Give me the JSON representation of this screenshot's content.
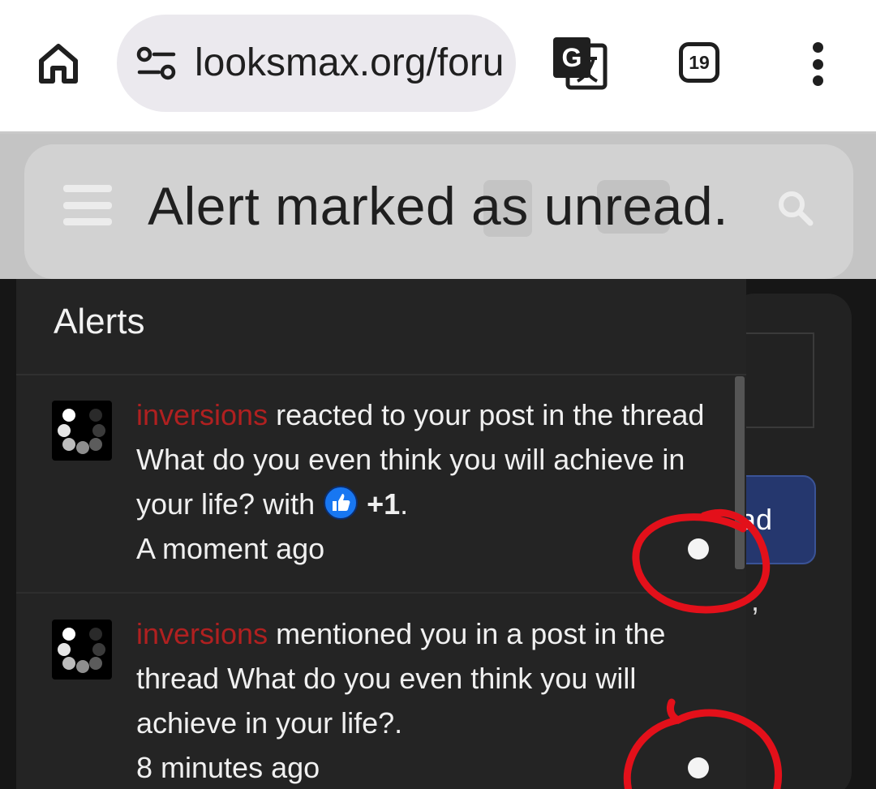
{
  "browser": {
    "url": "looksmax.org/forums",
    "tab_count": "19",
    "icons": {
      "home": "home-icon",
      "site_settings": "tune-icon",
      "translate": "translate-icon",
      "tabs": "tab-switcher-icon",
      "menu": "more-vert-icon"
    }
  },
  "toast": {
    "message": "Alert marked as unread."
  },
  "background_page": {
    "button_partial_label": "ad",
    "trailing_comma": ","
  },
  "alerts": {
    "title": "Alerts",
    "items": [
      {
        "user": "inversions",
        "text": " reacted to your post in the thread What do you even think you will achieve in your life? with ",
        "reaction_value": "+1",
        "suffix": ".",
        "time": "A moment ago",
        "unread": true
      },
      {
        "user": "inversions",
        "text": " mentioned you in a post in the thread What do you even think you will achieve in your life?.",
        "time": "8 minutes ago",
        "unread": true
      }
    ]
  },
  "colors": {
    "username": "#b02020",
    "panel_bg": "#242424",
    "annotation_red": "#e3101a",
    "like_blue": "#1877f2"
  }
}
